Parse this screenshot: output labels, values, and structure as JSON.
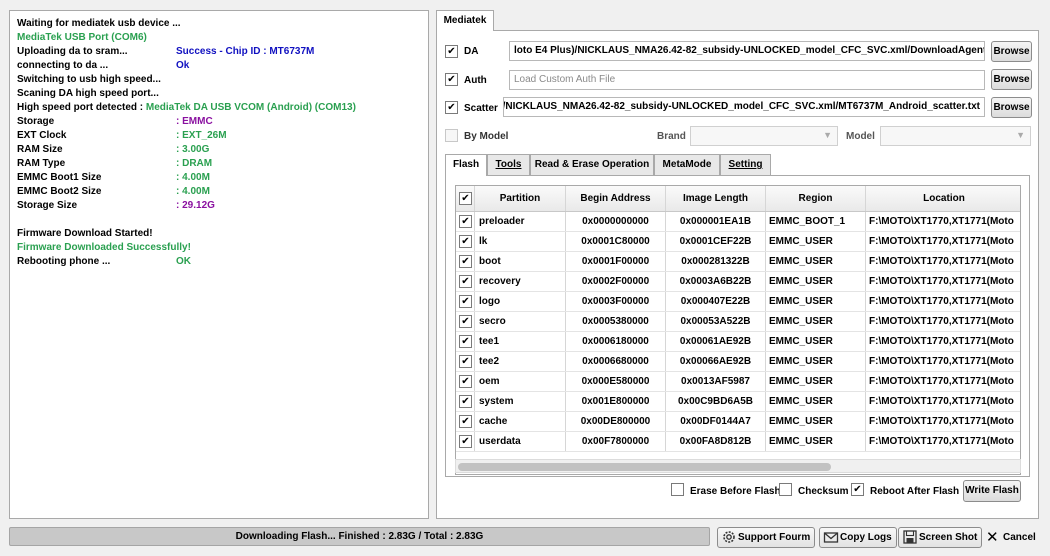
{
  "log": {
    "lines": [
      {
        "label": "Waiting for mediatek usb device ...",
        "value": ""
      },
      {
        "label": "MediaTek USB Port (COM6)",
        "value": ""
      },
      {
        "label": "Uploading da to sram...",
        "value": "Success - Chip ID  : MT6737M"
      },
      {
        "label": "connecting to da ...",
        "value": "Ok"
      },
      {
        "label": "Switching to usb high speed...",
        "value": ""
      },
      {
        "label": "Scaning DA high speed port...",
        "value": ""
      },
      {
        "label": "High speed port detected : ",
        "value": "MediaTek DA USB VCOM (Android) (COM13)"
      },
      {
        "label": "Storage",
        "value": ": EMMC"
      },
      {
        "label": "EXT Clock",
        "value": ": EXT_26M"
      },
      {
        "label": "RAM Size",
        "value": ": 3.00G"
      },
      {
        "label": "RAM Type",
        "value": ": DRAM"
      },
      {
        "label": "EMMC Boot1 Size",
        "value": ": 4.00M"
      },
      {
        "label": "EMMC Boot2 Size",
        "value": ": 4.00M"
      },
      {
        "label": "Storage Size",
        "value": ": 29.12G"
      },
      {
        "label": "Firmware Download Started!",
        "value": ""
      },
      {
        "label": "Firmware Downloaded Successfully!",
        "value": ""
      },
      {
        "label": "Rebooting phone ...",
        "value": "OK"
      }
    ],
    "colors": {
      "green": "#2aa050",
      "blue": "#1010c0",
      "purple": "#8a10a0"
    }
  },
  "main_tab": "Mediatek",
  "files": {
    "da": {
      "label": "DA",
      "checked": true,
      "value": "loto E4 Plus)/NICKLAUS_NMA26.42-82_subsidy-UNLOCKED_model_CFC_SVC.xml/DownloadAgent.bin",
      "button": "Browse"
    },
    "auth": {
      "label": "Auth",
      "checked": true,
      "placeholder": "Load Custom Auth File",
      "button": "Browse"
    },
    "scatter": {
      "label": "Scatter",
      "checked": true,
      "value": "Plus)/NICKLAUS_NMA26.42-82_subsidy-UNLOCKED_model_CFC_SVC.xml/MT6737M_Android_scatter.txt",
      "button": "Browse"
    },
    "by_model": {
      "label": "By Model",
      "checked": false
    },
    "brand_label": "Brand",
    "model_label": "Model"
  },
  "tabs": [
    {
      "label": "Flash",
      "active": true
    },
    {
      "label": "Tools",
      "active": false
    },
    {
      "label": "Read & Erase Operation",
      "active": false
    },
    {
      "label": "MetaMode",
      "active": false
    },
    {
      "label": "Setting",
      "active": false
    }
  ],
  "table": {
    "headers": [
      "Partition",
      "Begin Address",
      "Image Length",
      "Region",
      "Location"
    ],
    "rows": [
      {
        "partition": "preloader",
        "begin": "0x0000000000",
        "length": "0x000001EA1B",
        "region": "EMMC_BOOT_1",
        "location": "F:\\MOTO\\XT1770,XT1771(Moto"
      },
      {
        "partition": "lk",
        "begin": "0x0001C80000",
        "length": "0x0001CEF22B",
        "region": "EMMC_USER",
        "location": "F:\\MOTO\\XT1770,XT1771(Moto"
      },
      {
        "partition": "boot",
        "begin": "0x0001F00000",
        "length": "0x000281322B",
        "region": "EMMC_USER",
        "location": "F:\\MOTO\\XT1770,XT1771(Moto"
      },
      {
        "partition": "recovery",
        "begin": "0x0002F00000",
        "length": "0x0003A6B22B",
        "region": "EMMC_USER",
        "location": "F:\\MOTO\\XT1770,XT1771(Moto"
      },
      {
        "partition": "logo",
        "begin": "0x0003F00000",
        "length": "0x000407E22B",
        "region": "EMMC_USER",
        "location": "F:\\MOTO\\XT1770,XT1771(Moto"
      },
      {
        "partition": "secro",
        "begin": "0x0005380000",
        "length": "0x00053A522B",
        "region": "EMMC_USER",
        "location": "F:\\MOTO\\XT1770,XT1771(Moto"
      },
      {
        "partition": "tee1",
        "begin": "0x0006180000",
        "length": "0x00061AE92B",
        "region": "EMMC_USER",
        "location": "F:\\MOTO\\XT1770,XT1771(Moto"
      },
      {
        "partition": "tee2",
        "begin": "0x0006680000",
        "length": "0x00066AE92B",
        "region": "EMMC_USER",
        "location": "F:\\MOTO\\XT1770,XT1771(Moto"
      },
      {
        "partition": "oem",
        "begin": "0x000E580000",
        "length": "0x0013AF5987",
        "region": "EMMC_USER",
        "location": "F:\\MOTO\\XT1770,XT1771(Moto"
      },
      {
        "partition": "system",
        "begin": "0x001E800000",
        "length": "0x00C9BD6A5B",
        "region": "EMMC_USER",
        "location": "F:\\MOTO\\XT1770,XT1771(Moto"
      },
      {
        "partition": "cache",
        "begin": "0x00DE800000",
        "length": "0x00DF0144A7",
        "region": "EMMC_USER",
        "location": "F:\\MOTO\\XT1770,XT1771(Moto"
      },
      {
        "partition": "userdata",
        "begin": "0x00F7800000",
        "length": "0x00FA8D812B",
        "region": "EMMC_USER",
        "location": "F:\\MOTO\\XT1770,XT1771(Moto"
      }
    ]
  },
  "options": {
    "erase_before_flash": {
      "label": "Erase Before Flash",
      "checked": false
    },
    "checksum": {
      "label": "Checksum",
      "checked": false
    },
    "reboot_after_flash": {
      "label": "Reboot After Flash",
      "checked": true
    },
    "write_flash": "Write Flash"
  },
  "progress": {
    "text": "Downloading Flash... Finished : 2.83G / Total : 2.83G",
    "fraction": 1.0
  },
  "bottom": {
    "support": "Support Fourm",
    "copy_logs": "Copy Logs",
    "screenshot": "Screen Shot",
    "cancel": "Cancel"
  }
}
